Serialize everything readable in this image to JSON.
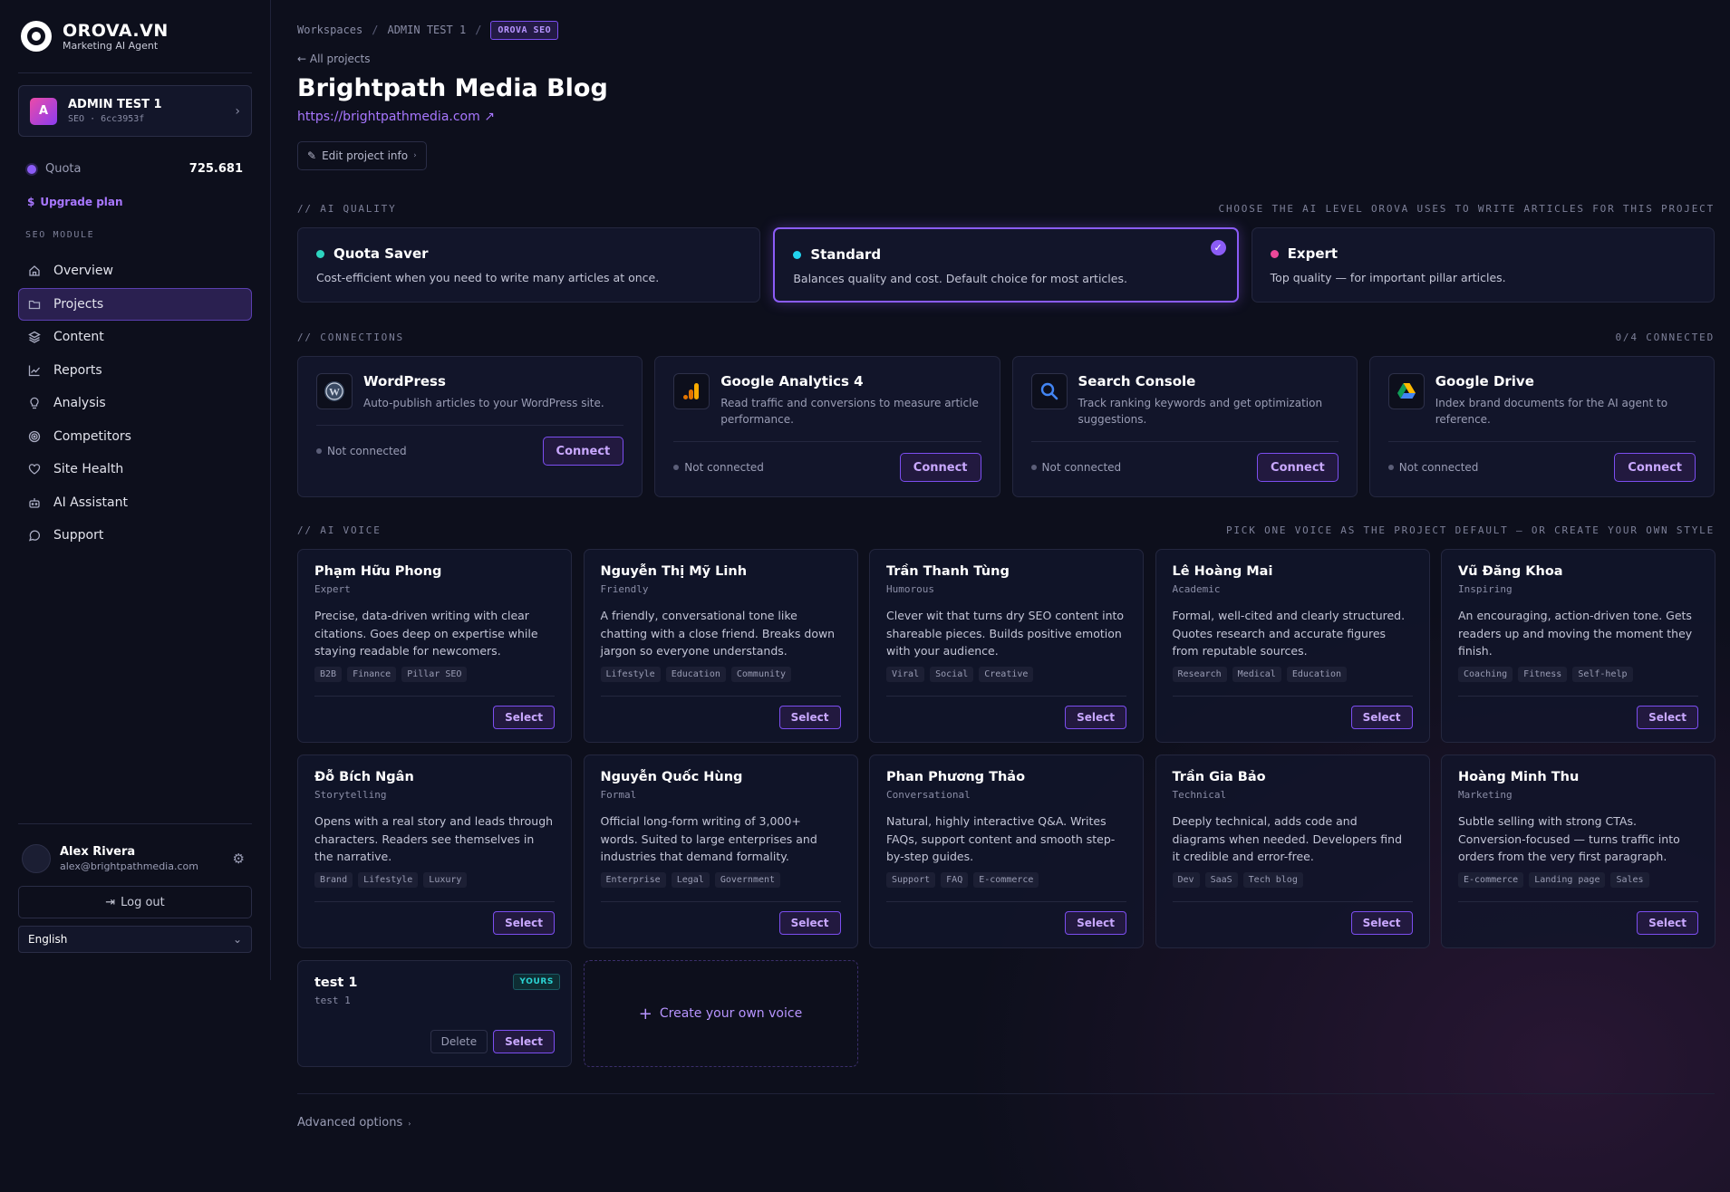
{
  "brand": {
    "name": "OROVA.VN",
    "subtitle": "Marketing AI Agent"
  },
  "workspace": {
    "initial": "A",
    "name": "ADMIN TEST 1",
    "meta": "SEO · 6cc3953f"
  },
  "quota": {
    "label": "Quota",
    "value": "725.681"
  },
  "upgrade_label": "Upgrade plan",
  "module_label": "SEO MODULE",
  "nav": [
    {
      "label": "Overview",
      "icon": "home-icon"
    },
    {
      "label": "Projects",
      "icon": "folder-icon"
    },
    {
      "label": "Content",
      "icon": "layers-icon"
    },
    {
      "label": "Reports",
      "icon": "chart-icon"
    },
    {
      "label": "Analysis",
      "icon": "bulb-icon"
    },
    {
      "label": "Competitors",
      "icon": "target-icon"
    },
    {
      "label": "Site Health",
      "icon": "heart-icon"
    },
    {
      "label": "AI Assistant",
      "icon": "robot-icon"
    },
    {
      "label": "Support",
      "icon": "chat-icon"
    }
  ],
  "user": {
    "name": "Alex Rivera",
    "email": "alex@brightpathmedia.com"
  },
  "logout_label": "Log out",
  "language": "English",
  "breadcrumb": {
    "a": "Workspaces",
    "b": "ADMIN TEST 1",
    "c": "OROVA SEO"
  },
  "back_label": "← All projects",
  "project": {
    "title": "Brightpath Media Blog",
    "url": "https://brightpathmedia.com ↗",
    "edit_label": "Edit project info"
  },
  "ai_quality": {
    "heading": "// AI QUALITY",
    "hint": "CHOOSE THE AI LEVEL OROVA USES TO WRITE ARTICLES FOR THIS PROJECT",
    "options": [
      {
        "title": "Quota Saver",
        "desc": "Cost-efficient when you need to write many articles at once.",
        "color": "#2dd4bf"
      },
      {
        "title": "Standard",
        "desc": "Balances quality and cost. Default choice for most articles.",
        "color": "#22d3ee"
      },
      {
        "title": "Expert",
        "desc": "Top quality — for important pillar articles.",
        "color": "#ec4899"
      }
    ]
  },
  "connections": {
    "heading": "// CONNECTIONS",
    "count": "0/4 CONNECTED",
    "items": [
      {
        "name": "WordPress",
        "desc": "Auto-publish articles to your WordPress site.",
        "status": "Not connected",
        "button": "Connect"
      },
      {
        "name": "Google Analytics 4",
        "desc": "Read traffic and conversions to measure article performance.",
        "status": "Not connected",
        "button": "Connect"
      },
      {
        "name": "Search Console",
        "desc": "Track ranking keywords and get optimization suggestions.",
        "status": "Not connected",
        "button": "Connect"
      },
      {
        "name": "Google Drive",
        "desc": "Index brand documents for the AI agent to reference.",
        "status": "Not connected",
        "button": "Connect"
      }
    ]
  },
  "ai_voice": {
    "heading": "// AI VOICE",
    "hint": "PICK ONE VOICE AS THE PROJECT DEFAULT — OR CREATE YOUR OWN STYLE",
    "select_label": "Select",
    "voices": [
      {
        "name": "Phạm Hữu Phong",
        "style": "Expert",
        "desc": "Precise, data-driven writing with clear citations. Goes deep on expertise while staying readable for newcomers.",
        "tags": [
          "B2B",
          "Finance",
          "Pillar SEO"
        ]
      },
      {
        "name": "Nguyễn Thị Mỹ Linh",
        "style": "Friendly",
        "desc": "A friendly, conversational tone like chatting with a close friend. Breaks down jargon so everyone understands.",
        "tags": [
          "Lifestyle",
          "Education",
          "Community"
        ]
      },
      {
        "name": "Trần Thanh Tùng",
        "style": "Humorous",
        "desc": "Clever wit that turns dry SEO content into shareable pieces. Builds positive emotion with your audience.",
        "tags": [
          "Viral",
          "Social",
          "Creative"
        ]
      },
      {
        "name": "Lê Hoàng Mai",
        "style": "Academic",
        "desc": "Formal, well-cited and clearly structured. Quotes research and accurate figures from reputable sources.",
        "tags": [
          "Research",
          "Medical",
          "Education"
        ]
      },
      {
        "name": "Vũ Đăng Khoa",
        "style": "Inspiring",
        "desc": "An encouraging, action-driven tone. Gets readers up and moving the moment they finish.",
        "tags": [
          "Coaching",
          "Fitness",
          "Self-help"
        ]
      },
      {
        "name": "Đỗ Bích Ngân",
        "style": "Storytelling",
        "desc": "Opens with a real story and leads through characters. Readers see themselves in the narrative.",
        "tags": [
          "Brand",
          "Lifestyle",
          "Luxury"
        ]
      },
      {
        "name": "Nguyễn Quốc Hùng",
        "style": "Formal",
        "desc": "Official long-form writing of 3,000+ words. Suited to large enterprises and industries that demand formality.",
        "tags": [
          "Enterprise",
          "Legal",
          "Government"
        ]
      },
      {
        "name": "Phan Phương Thảo",
        "style": "Conversational",
        "desc": "Natural, highly interactive Q&A. Writes FAQs, support content and smooth step-by-step guides.",
        "tags": [
          "Support",
          "FAQ",
          "E-commerce"
        ]
      },
      {
        "name": "Trần Gia Bảo",
        "style": "Technical",
        "desc": "Deeply technical, adds code and diagrams when needed. Developers find it credible and error-free.",
        "tags": [
          "Dev",
          "SaaS",
          "Tech blog"
        ]
      },
      {
        "name": "Hoàng Minh Thu",
        "style": "Marketing",
        "desc": "Subtle selling with strong CTAs. Conversion-focused — turns traffic into orders from the very first paragraph.",
        "tags": [
          "E-commerce",
          "Landing page",
          "Sales"
        ]
      }
    ],
    "custom": {
      "name": "test 1",
      "style": "test 1",
      "badge": "YOURS",
      "delete_label": "Delete"
    },
    "create_label": "Create your own voice"
  },
  "advanced_label": "Advanced options"
}
